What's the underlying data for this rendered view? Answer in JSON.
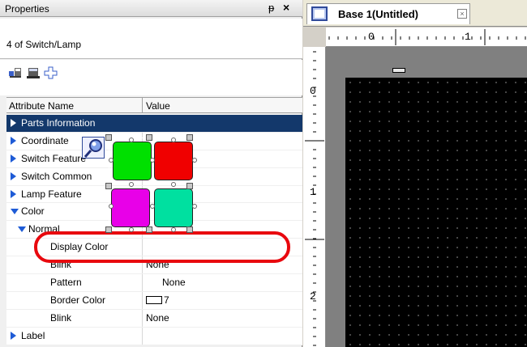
{
  "properties": {
    "title": "Properties",
    "pin_glyph": "ᵽ",
    "close_glyph": "×",
    "selection_info": "4 of Switch/Lamp",
    "toolbar_icons": [
      "sort-category-icon",
      "sort-list-icon",
      "expand-icon"
    ],
    "columns": {
      "name": "Attribute Name",
      "value": "Value"
    },
    "rows": [
      {
        "label": "Parts Information",
        "value": "",
        "indent": 0,
        "arrow": "right",
        "selected": true
      },
      {
        "label": "Coordinate",
        "value": "",
        "indent": 0,
        "arrow": "right",
        "selected": false
      },
      {
        "label": "Switch Feature",
        "value": "",
        "indent": 0,
        "arrow": "right",
        "selected": false
      },
      {
        "label": "Switch Common",
        "value": "",
        "indent": 0,
        "arrow": "right",
        "selected": false
      },
      {
        "label": "Lamp Feature",
        "value": "",
        "indent": 0,
        "arrow": "right",
        "selected": false
      },
      {
        "label": "Color",
        "value": "",
        "indent": 0,
        "arrow": "down",
        "selected": false
      },
      {
        "label": "Normal",
        "value": "",
        "indent": 1,
        "arrow": "down",
        "selected": false
      },
      {
        "label": "Display Color",
        "value": "",
        "indent": 2,
        "arrow": "",
        "selected": false
      },
      {
        "label": "Blink",
        "value": "None",
        "indent": 2,
        "arrow": "",
        "selected": false
      },
      {
        "label": "Pattern",
        "value": "None",
        "indent": 2,
        "arrow": "",
        "selected": false
      },
      {
        "label": "Border Color",
        "value": "7",
        "indent": 2,
        "arrow": "",
        "selected": false,
        "swatch": true
      },
      {
        "label": "Blink",
        "value": "None",
        "indent": 2,
        "arrow": "",
        "selected": false
      },
      {
        "label": "Label",
        "value": "",
        "indent": 0,
        "arrow": "right",
        "selected": false
      }
    ]
  },
  "editor": {
    "tab_label": "Base 1(Untitled)",
    "tab_close_glyph": "×",
    "hruler_marks": [
      "0",
      "1"
    ],
    "vruler_marks": [
      "0",
      "1",
      "2"
    ],
    "lamps": [
      {
        "name": "lamp-green",
        "color": "#00e000"
      },
      {
        "name": "lamp-red",
        "color": "#f00000"
      },
      {
        "name": "lamp-magenta",
        "color": "#e800e8"
      },
      {
        "name": "lamp-teal",
        "color": "#00e0a0"
      }
    ],
    "colors": {
      "screen": "#000000",
      "bezel": "#808080",
      "highlight_ring": "#e8080e",
      "selected_row": "#13386b"
    }
  }
}
